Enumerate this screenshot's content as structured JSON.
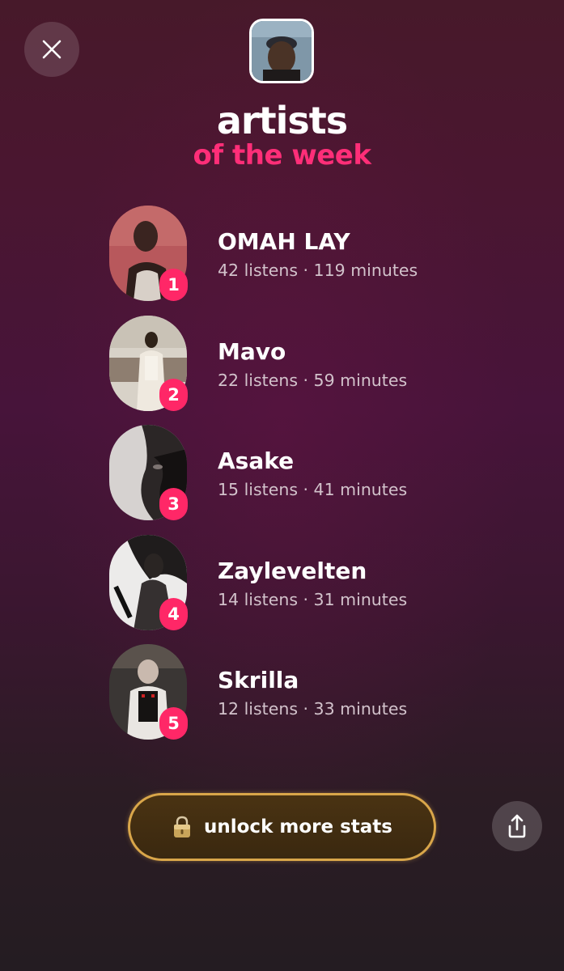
{
  "header": {
    "close_icon": "close-icon",
    "avatar_icon": "user-avatar",
    "title": "artists",
    "subtitle": "of the week"
  },
  "artists": [
    {
      "rank": "1",
      "name": "OMAH LAY",
      "stats": "42 listens · 119 minutes"
    },
    {
      "rank": "2",
      "name": "Mavo",
      "stats": "22 listens · 59 minutes"
    },
    {
      "rank": "3",
      "name": "Asake",
      "stats": "15 listens · 41 minutes"
    },
    {
      "rank": "4",
      "name": "Zaylevelten",
      "stats": "14 listens · 31 minutes"
    },
    {
      "rank": "5",
      "name": "Skrilla",
      "stats": "12 listens · 33 minutes"
    }
  ],
  "footer": {
    "unlock_label": "unlock more stats",
    "lock_icon": "lock-icon",
    "share_icon": "share-icon"
  },
  "colors": {
    "accent": "#ff2e78",
    "badge": "#ff2767",
    "gold_border": "#d9a64a"
  }
}
